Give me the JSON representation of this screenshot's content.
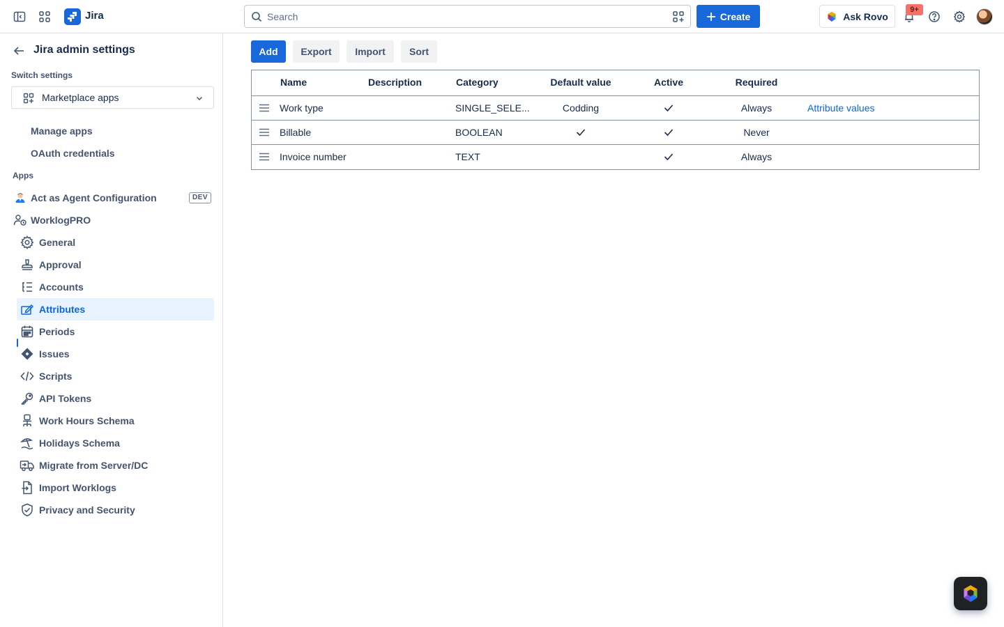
{
  "app": {
    "name": "Jira"
  },
  "topbar": {
    "search_placeholder": "Search",
    "create_label": "Create",
    "rovo_label": "Ask Rovo",
    "notifications_badge": "9+"
  },
  "sidebar": {
    "title": "Jira admin settings",
    "switch_label": "Switch settings",
    "switch_value": "Marketplace apps",
    "sub_items": [
      {
        "label": "Manage apps"
      },
      {
        "label": "OAuth credentials"
      }
    ],
    "apps_label": "Apps",
    "apps": [
      {
        "label": "Act as Agent Configuration",
        "badge": "DEV",
        "icon": "agent-icon"
      },
      {
        "label": "WorklogPRO",
        "icon": "people-icon"
      }
    ],
    "items": [
      {
        "label": "General",
        "icon": "gear-icon"
      },
      {
        "label": "Approval",
        "icon": "stamp-icon"
      },
      {
        "label": "Accounts",
        "icon": "list-icon"
      },
      {
        "label": "Attributes",
        "icon": "edit-icon",
        "active": true
      },
      {
        "label": "Periods",
        "icon": "calendar-icon"
      },
      {
        "label": "Issues",
        "icon": "diamond-icon"
      },
      {
        "label": "Scripts",
        "icon": "code-icon"
      },
      {
        "label": "API Tokens",
        "icon": "key-icon"
      },
      {
        "label": "Work Hours Schema",
        "icon": "office-chair-icon"
      },
      {
        "label": "Holidays Schema",
        "icon": "beach-icon"
      },
      {
        "label": "Migrate from Server/DC",
        "icon": "truck-icon"
      },
      {
        "label": "Import Worklogs",
        "icon": "file-import-icon"
      },
      {
        "label": "Privacy and Security",
        "icon": "shield-icon"
      }
    ]
  },
  "toolbar": {
    "add_label": "Add",
    "export_label": "Export",
    "import_label": "Import",
    "sort_label": "Sort"
  },
  "table": {
    "headers": {
      "name": "Name",
      "description": "Description",
      "category": "Category",
      "default_value": "Default value",
      "active": "Active",
      "required": "Required"
    },
    "rows": [
      {
        "name": "Work type",
        "description": "",
        "category": "SINGLE_SELE...",
        "default_value": "Codding",
        "default_checked": false,
        "active": true,
        "required": "Always",
        "action": "Attribute values"
      },
      {
        "name": "Billable",
        "description": "",
        "category": "BOOLEAN",
        "default_value": "",
        "default_checked": true,
        "active": true,
        "required": "Never",
        "action": ""
      },
      {
        "name": "Invoice number",
        "description": "",
        "category": "TEXT",
        "default_value": "",
        "default_checked": false,
        "active": true,
        "required": "Always",
        "action": ""
      }
    ]
  },
  "colors": {
    "primary": "#1868db",
    "active_bg": "#e9f2ff",
    "active_text": "#0c66e4",
    "notification_badge": "#f87168"
  }
}
